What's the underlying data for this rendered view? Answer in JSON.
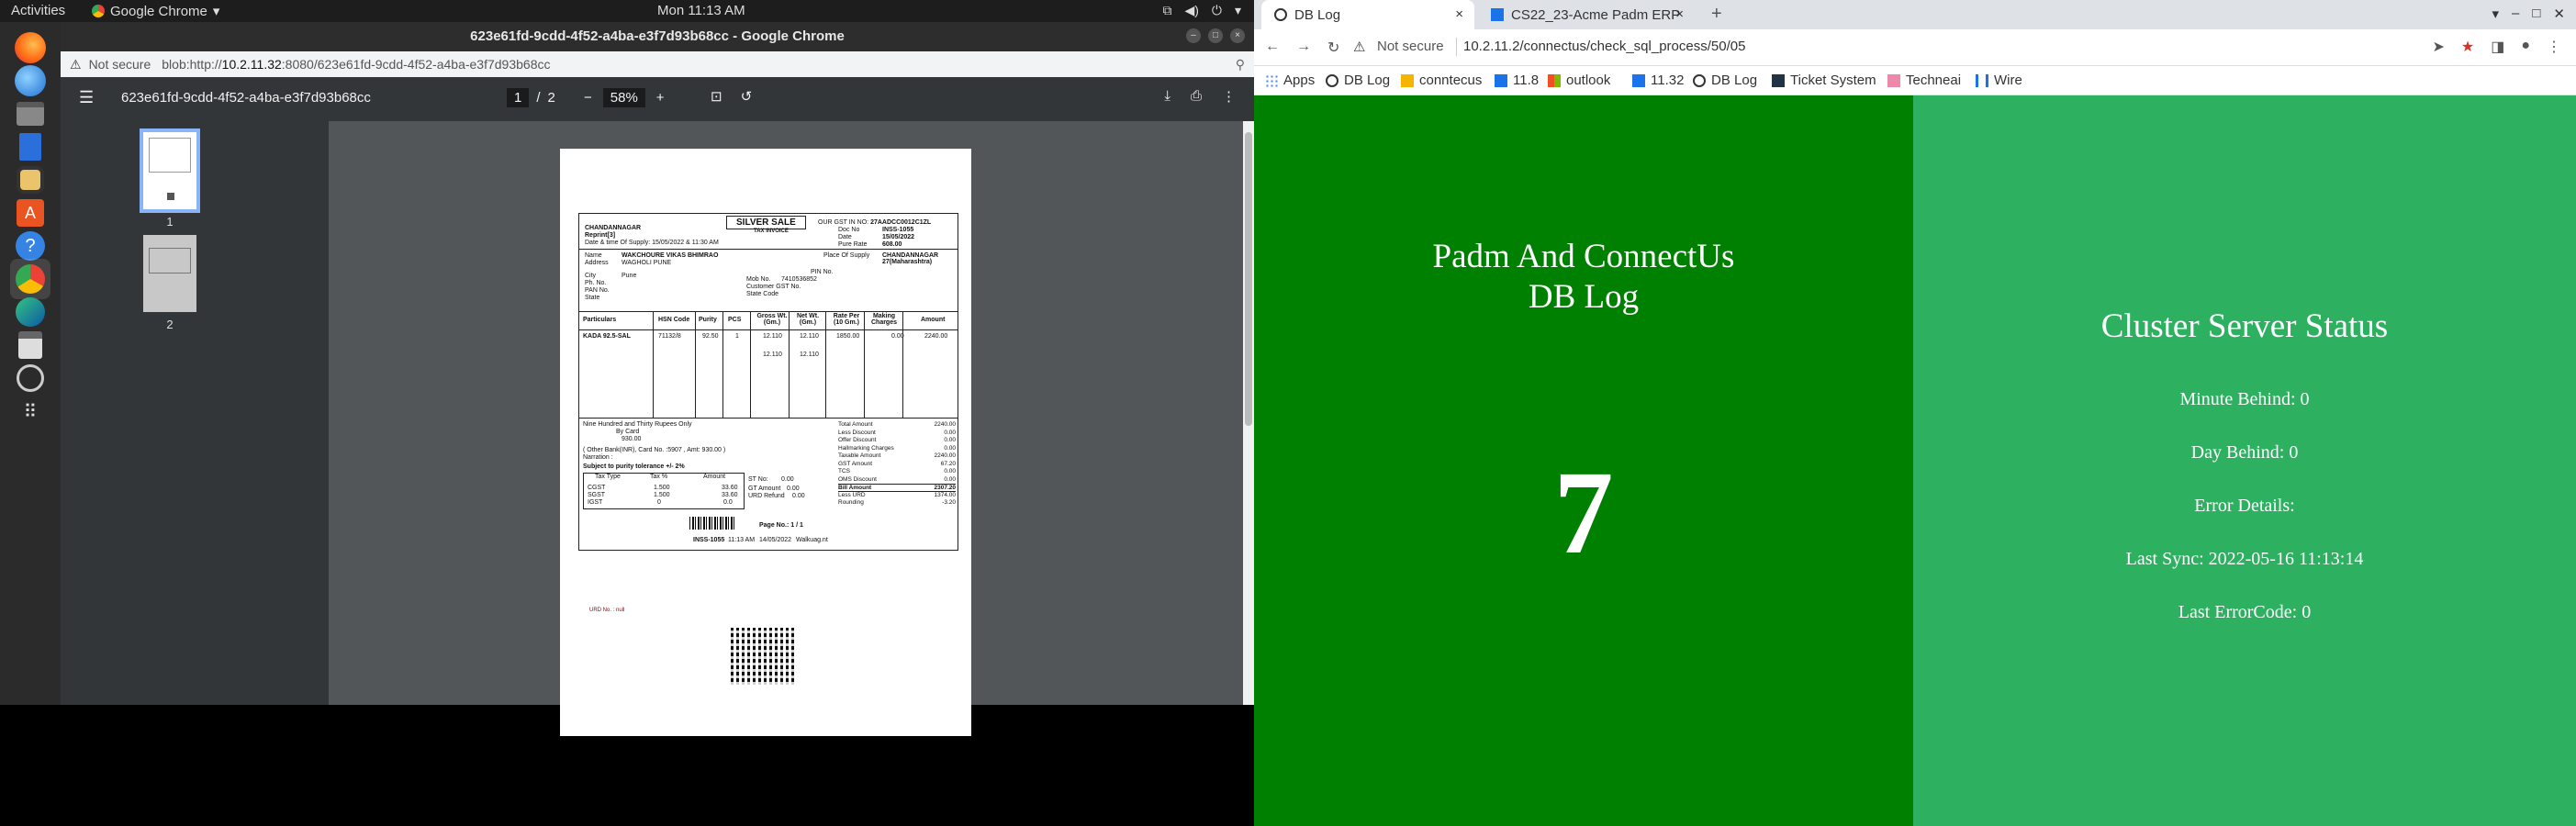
{
  "topbar": {
    "activities": "Activities",
    "app": "Google Chrome",
    "clock": "Mon 11:13 AM"
  },
  "pdf_window": {
    "title": "623e61fd-9cdd-4f52-a4ba-e3f7d93b68cc - Google Chrome",
    "not_secure": "Not secure",
    "url_prefix": "blob:http://",
    "url_host": "10.2.11.32",
    "url_rest": ":8080/623e61fd-9cdd-4f52-a4ba-e3f7d93b68cc",
    "file_name": "623e61fd-9cdd-4f52-a4ba-e3f7d93b68cc",
    "page_current": "1",
    "page_sep": "/",
    "page_total": "2",
    "zoom": "58%",
    "thumb_labels": [
      "1",
      "2"
    ]
  },
  "invoice": {
    "sale_title": "SILVER SALE",
    "tax_invoice": "TAX INVOICE",
    "gst_label": "OUR GST IN NO:",
    "gst_value": "27AADCC0012C1ZL",
    "branch": "CHANDANNAGAR",
    "reprint": "Reprint[3]",
    "supply_time": "Date & time Of Supply: 15/05/2022 & 11:30 AM",
    "doc_no_label": "Doc No",
    "doc_no": "INSS-1055",
    "date_label": "Date",
    "date": "15/05/2022",
    "pure_rate_label": "Pure Rate",
    "pure_rate": "608.00",
    "name_label": "Name",
    "name": "WAKCHOURE VIKAS BHIMRAO",
    "address_label": "Address",
    "address": "WAGHOLI PUNE",
    "place_label": "Place Of Supply",
    "place": "CHANDANNAGAR 27(Maharashtra)",
    "city_label": "City",
    "city": "Pune",
    "pin_label": "PIN No.",
    "ph_label": "Ph. No.",
    "mob_label": "Mob No.",
    "mob": "7410536852",
    "pan_label": "PAN No.",
    "cust_gst_label": "Customer GST No.",
    "state_label": "State",
    "state_code_label": "State Code",
    "columns": [
      "Particulars",
      "HSN Code",
      "Purity",
      "PCS",
      "Gross Wt. (Gm.)",
      "Net Wt. (Gm.)",
      "Rate Per (10 Gm.)",
      "Making Charges",
      "Amount"
    ],
    "row": [
      "KADA 92.5-SAL",
      "71132/8",
      "92.50",
      "1",
      "12.110",
      "12.110",
      "1850.00",
      "0.00",
      "2240.00"
    ],
    "sub_gross": "12.110",
    "sub_net": "12.110",
    "words": "Nine Hundred and Thirty Rupees Only",
    "by_card": "By Card",
    "card_amt": "930.00",
    "other_bank": "( Other Bank(INR), Card No. :5907 , Amt: 930.00 )",
    "narration": "Narration :",
    "subject": "Subject to purity tolerance +/- 2%",
    "tax_head": [
      "Tax Type",
      "Tax %",
      "Amount"
    ],
    "tax_rows": [
      [
        "CGST",
        "1.500",
        "33.60"
      ],
      [
        "SGST",
        "1.500",
        "33.60"
      ],
      [
        "IGST",
        "0",
        "0.0"
      ]
    ],
    "st_no": "ST No:",
    "st_no_v": "0.00",
    "gt_amount": "GT Amount",
    "gt_amount_v": "0.00",
    "urd_refund": "URD Refund",
    "urd_refund_v": "0.00",
    "totals": [
      [
        "Total Amount",
        "2240.00"
      ],
      [
        "Less Discount",
        "0.00"
      ],
      [
        "Offer Discount",
        "0.00"
      ],
      [
        "Hallmarking Charges",
        "0.00"
      ],
      [
        "Taxable Amount",
        "2240.00"
      ],
      [
        "GST Amount",
        "67.20"
      ],
      [
        "TCS",
        "0.00"
      ],
      [
        "OMS Discount",
        "0.00"
      ],
      [
        "Bill Amount",
        "2307.20"
      ],
      [
        "Less URD",
        "1374.00"
      ],
      [
        "Rounding",
        "-3.20"
      ]
    ],
    "page_no": "Page No.: 1 / 1",
    "footer": [
      "INSS-1055",
      "11:13 AM",
      "14/05/2022",
      "Walkuag.nt"
    ],
    "red_text": "URD No. : null"
  },
  "right_browser": {
    "tab1": "DB Log",
    "tab2": "CS22_23-Acme Padm ERP",
    "not_secure": "Not secure",
    "url": "10.2.11.2/connectus/check_sql_process/50/05",
    "bookmarks": [
      "Apps",
      "DB Log",
      "conntecus",
      "11.8",
      "outlook",
      "11.32",
      "DB Log",
      "Ticket System",
      "Techneai",
      "Wire"
    ]
  },
  "dashboard": {
    "title_line1": "Padm And ConnectUs",
    "title_line2": "DB Log",
    "big_number": "7",
    "cluster_title": "Cluster Server Status",
    "minute_behind": "Minute Behind: 0",
    "day_behind": "Day Behind: 0",
    "error_details": "Error Details:",
    "last_sync": "Last Sync: 2022-05-16 11:13:14",
    "last_error": "Last ErrorCode: 0"
  },
  "colors": {
    "left_panel": "#008000",
    "right_panel": "#2eb061"
  }
}
